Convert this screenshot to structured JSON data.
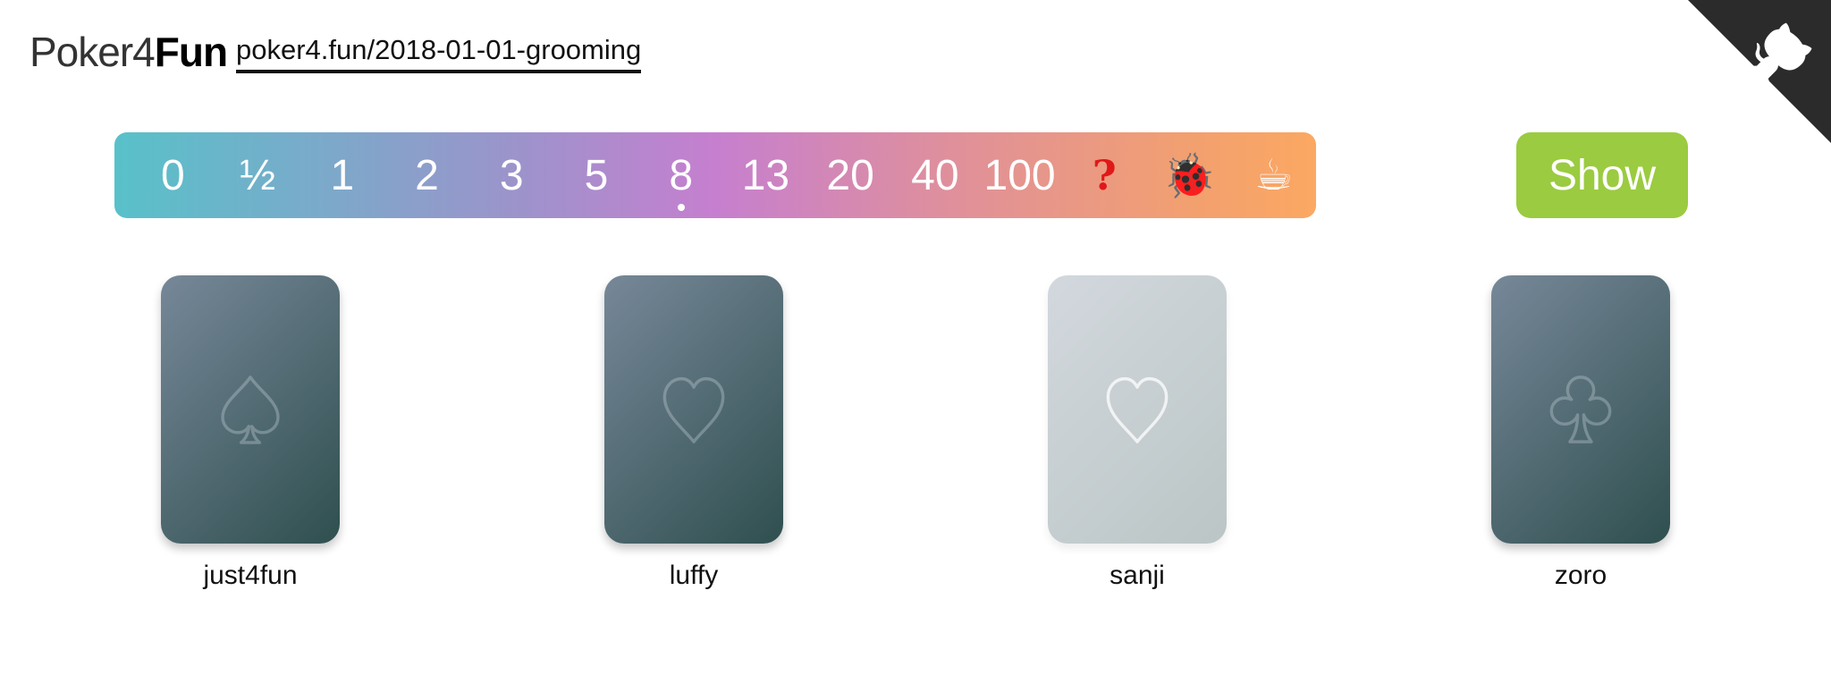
{
  "header": {
    "logo_light": "Poker4",
    "logo_bold": "Fun",
    "room_link": "poker4.fun/2018-01-01-grooming"
  },
  "github_corner": {
    "icon": "github-octocat-icon"
  },
  "selector": {
    "values": [
      "0",
      "½",
      "1",
      "2",
      "3",
      "5",
      "8",
      "13",
      "20",
      "40",
      "100",
      "?",
      "🐞",
      "☕"
    ],
    "selected_value": "8",
    "gradient": [
      "#58c1c9",
      "#9b94cb",
      "#c67fcf",
      "#e0909a",
      "#fba862"
    ]
  },
  "show_button": {
    "label": "Show",
    "color": "#9bcb40"
  },
  "players": [
    {
      "name": "just4fun",
      "suit": "spade-icon",
      "state": "voted"
    },
    {
      "name": "luffy",
      "suit": "heart-icon",
      "state": "voted"
    },
    {
      "name": "sanji",
      "suit": "heart-icon",
      "state": "not-voted"
    },
    {
      "name": "zoro",
      "suit": "club-icon",
      "state": "voted"
    }
  ]
}
